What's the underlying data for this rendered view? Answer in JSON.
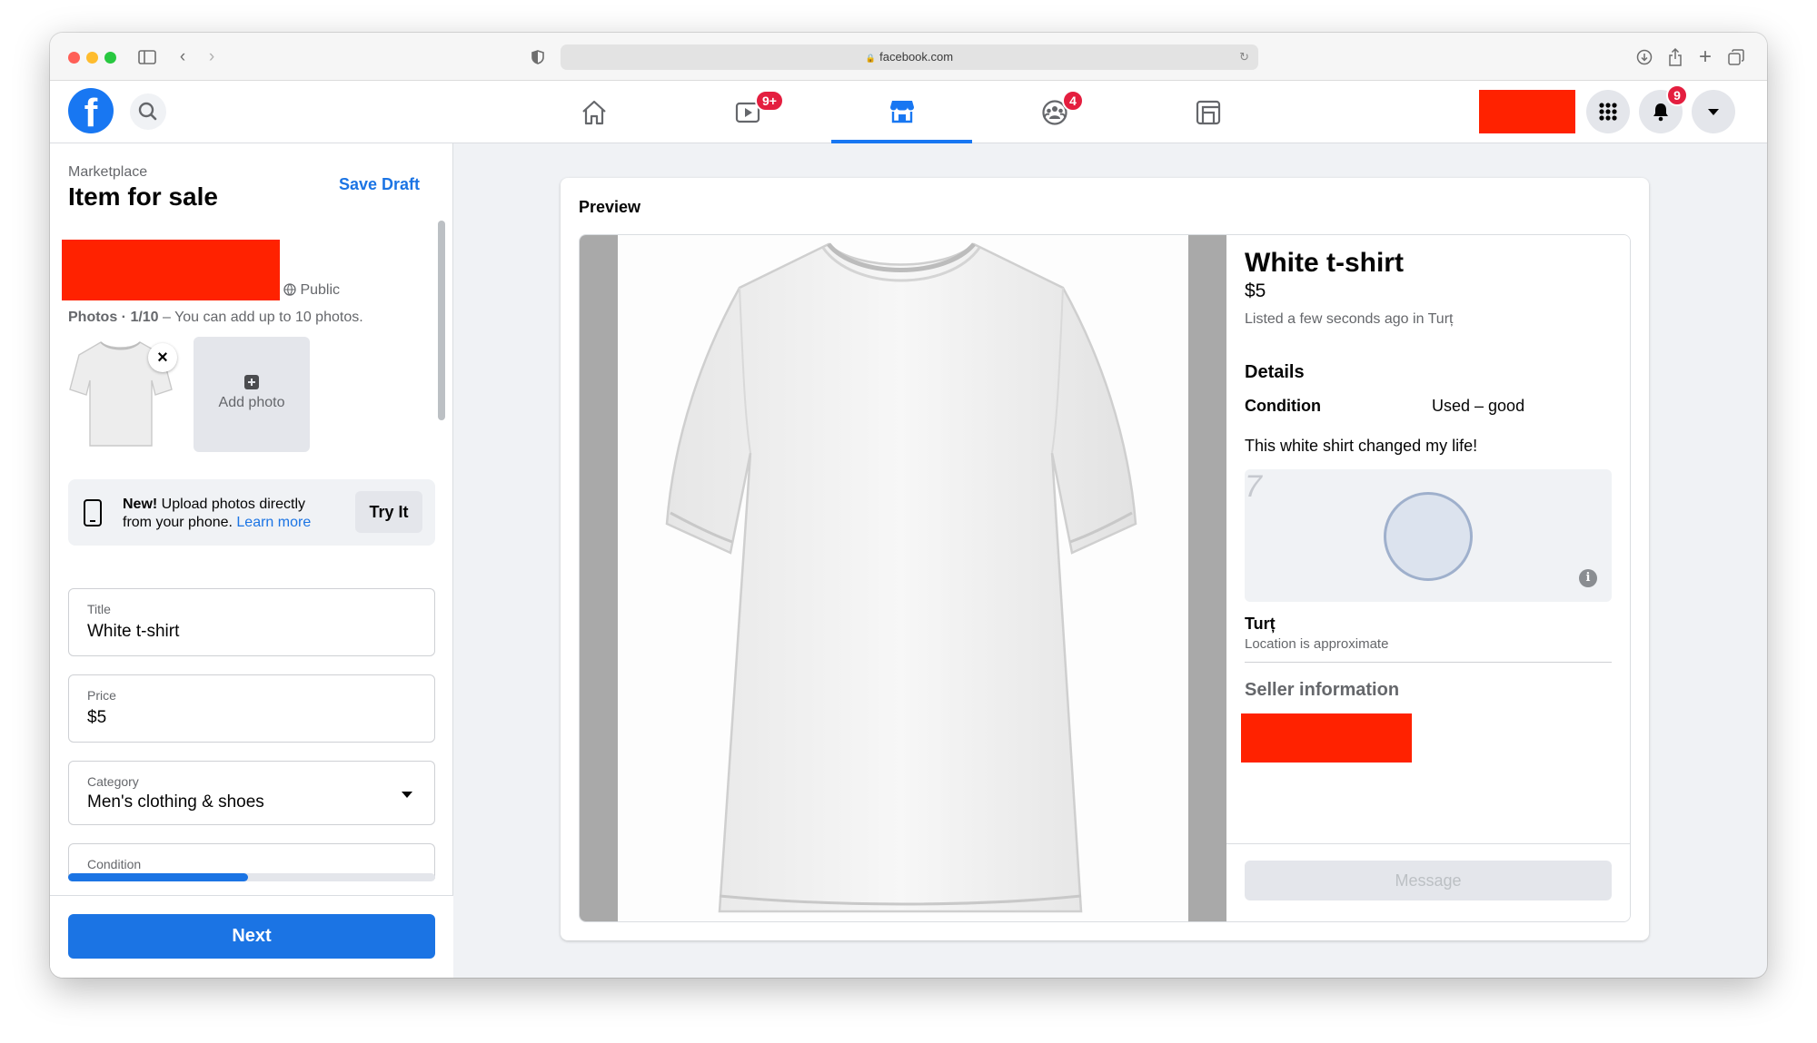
{
  "browser": {
    "url": "facebook.com",
    "traffic_lights": [
      "#ff5f57",
      "#febc2e",
      "#28c840"
    ]
  },
  "navbar": {
    "logo": "f",
    "tabs": [
      {
        "name": "home",
        "badge": ""
      },
      {
        "name": "watch",
        "badge": "9+"
      },
      {
        "name": "marketplace",
        "badge": ""
      },
      {
        "name": "groups",
        "badge": "4"
      },
      {
        "name": "gaming",
        "badge": ""
      }
    ],
    "notifications_badge": "9",
    "accent": "#1877f2"
  },
  "composer": {
    "breadcrumb": "Marketplace",
    "title": "Item for sale",
    "save_draft": "Save Draft",
    "audience": "Public",
    "photos_label": "Photos · 1/10",
    "photos_hint": " – You can add up to 10 photos.",
    "add_photo": "Add photo",
    "promo_bold": "New!",
    "promo_text_1": " Upload photos directly",
    "promo_text_2": "from your phone. ",
    "promo_link": "Learn more",
    "try_it": "Try It",
    "fields": {
      "title_label": "Title",
      "title_value": "White t-shirt",
      "price_label": "Price",
      "price_value": "$5",
      "category_label": "Category",
      "category_value": "Men's clothing & shoes",
      "condition_label": "Condition"
    },
    "progress": 0.49,
    "next": "Next"
  },
  "preview": {
    "heading": "Preview",
    "title": "White t-shirt",
    "price": "$5",
    "listed": "Listed a few seconds ago in Turț",
    "details": "Details",
    "condition_label": "Condition",
    "condition_value": "Used – good",
    "description": "This white shirt changed my life!",
    "map_glyph": "7",
    "location": "Turț",
    "location_note": "Location is approximate",
    "seller_info": "Seller information",
    "message": "Message"
  }
}
